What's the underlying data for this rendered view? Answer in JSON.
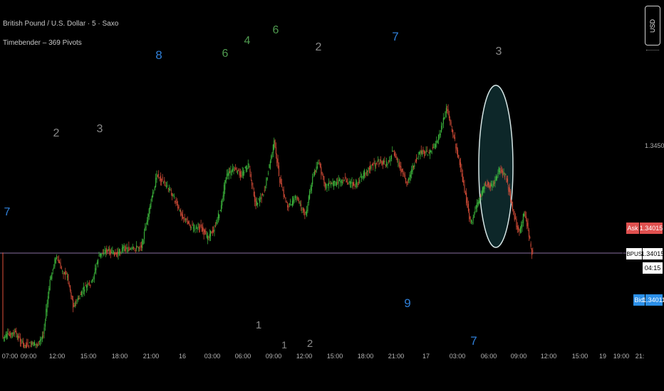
{
  "legend": {
    "symbol": "British Pound / U.S. Dollar · 5 · Saxo",
    "indicator": "Timebender – 369 Pivots"
  },
  "price_axis": {
    "currency": "USD",
    "price_label": "1.34500",
    "ask_label": "Ask",
    "ask_value": "1.34015",
    "symbol_tag": "GBPUSD",
    "last_value": "1.34015",
    "countdown": "04:15",
    "bid_label": "Bid",
    "bid_value": "1.34011"
  },
  "time_axis": {
    "labels": [
      "07:00",
      "09:00",
      "12:00",
      "15:00",
      "18:00",
      "21:00",
      "16",
      "03:00",
      "06:00",
      "09:00",
      "12:00",
      "15:00",
      "18:00",
      "21:00",
      "17",
      "03:00",
      "06:00",
      "09:00",
      "12:00",
      "15:00",
      "19",
      "19:00",
      "21:"
    ]
  },
  "pivot_numbers": [
    "2",
    "3",
    "8",
    "6",
    "4",
    "6",
    "2",
    "7",
    "3",
    "7",
    "1",
    "1",
    "2",
    "9",
    "7"
  ],
  "colors": {
    "background": "#000000",
    "up_candle": "#3fbf3f",
    "down_candle": "#e0503a",
    "gray_pivot": "#8a8a8a",
    "green_pivot": "#4f9a4f",
    "blue_pivot": "#2f7fd8",
    "ask_tag": "#e0504f",
    "bid_tag": "#2b8fe8",
    "highlight_fill": "#0f2e30",
    "price_line": "#5a4a6a"
  },
  "chart_data": {
    "type": "candlestick",
    "symbol": "GBPUSD",
    "timeframe": "5",
    "current_price": 1.34015,
    "price_axis_ticks": [
      1.345
    ],
    "x": [
      "07:00",
      "09:00",
      "12:00",
      "15:00",
      "18:00",
      "21:00",
      "16",
      "03:00",
      "06:00",
      "09:00",
      "12:00",
      "15:00",
      "18:00",
      "21:00",
      "17",
      "03:00",
      "06:00",
      "09:00"
    ],
    "close": [
      1.337,
      1.338,
      1.3399,
      1.3396,
      1.3401,
      1.3428,
      1.3418,
      1.341,
      1.3425,
      1.343,
      1.3427,
      1.3429,
      1.3434,
      1.3441,
      1.3445,
      1.3458,
      1.342,
      1.3405
    ]
  }
}
